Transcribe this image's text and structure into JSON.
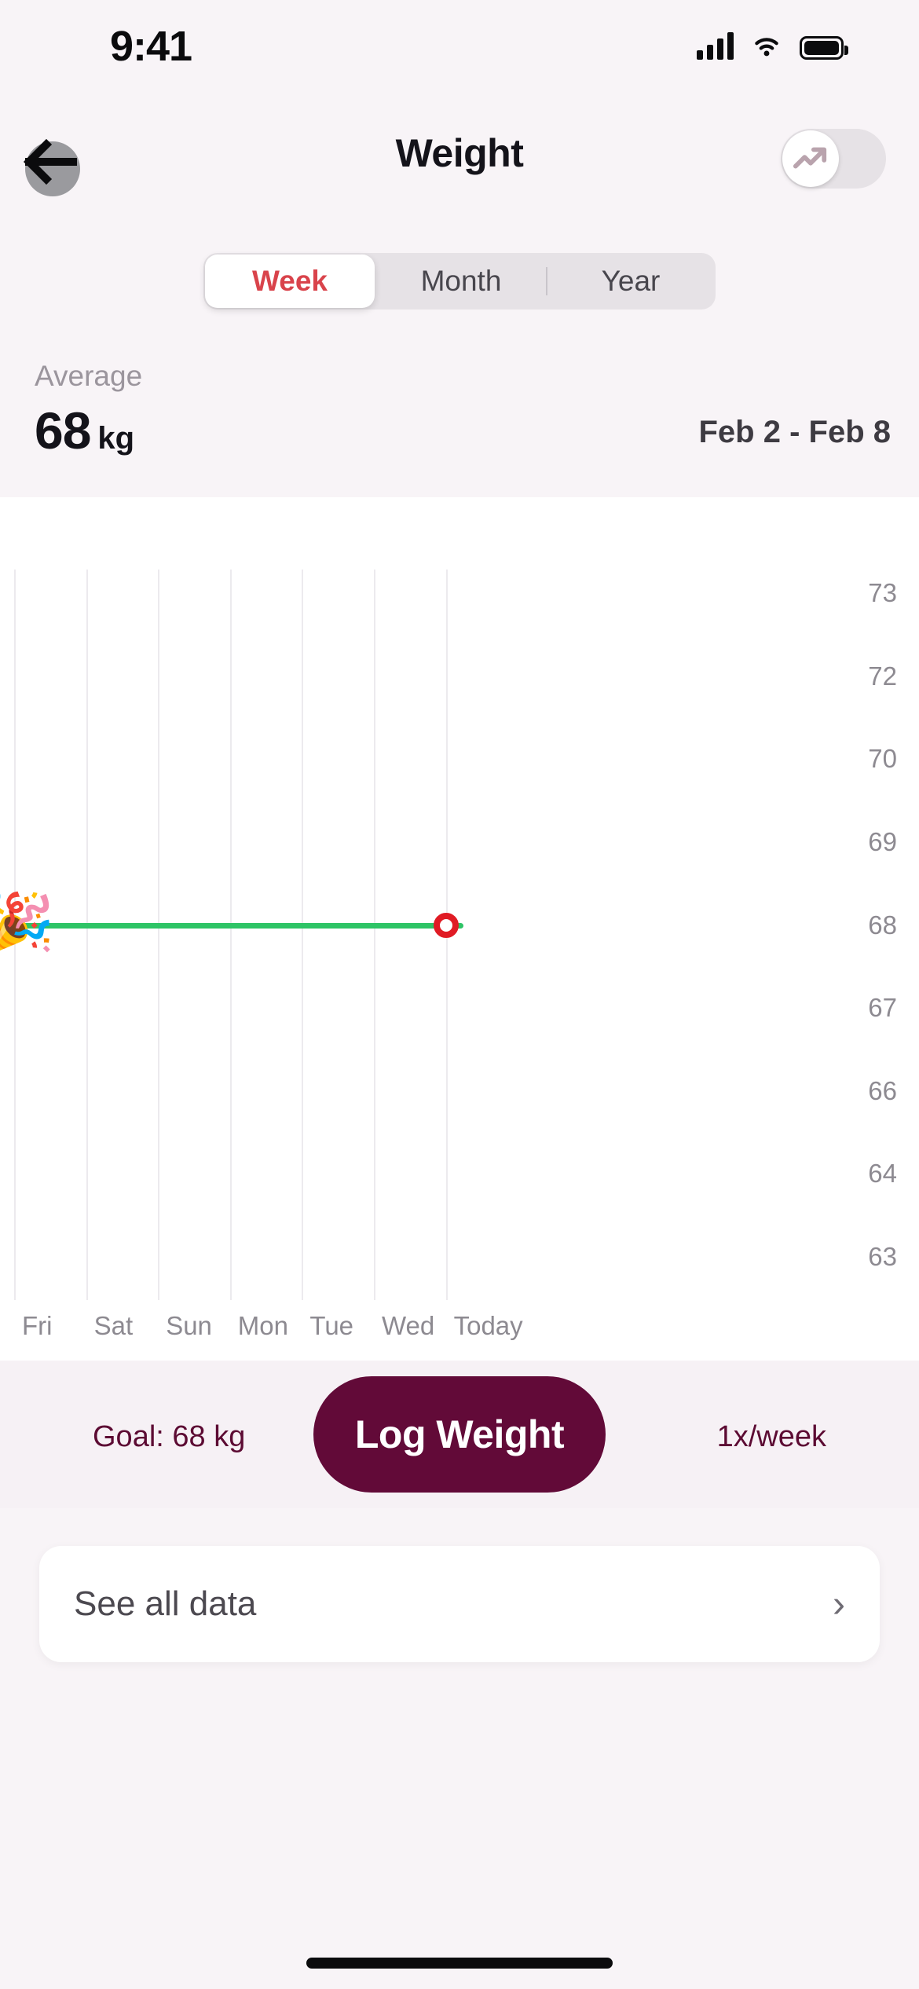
{
  "status_bar": {
    "time": "9:41",
    "cellular_icon": "signal-bars-icon",
    "wifi_icon": "wifi-icon",
    "battery_icon": "battery-full-icon"
  },
  "nav": {
    "back_icon": "back-arrow-icon",
    "title": "Weight",
    "toggle_icon": "trending-up-icon",
    "toggle_state": "off"
  },
  "segmented": {
    "options": [
      {
        "label": "Week",
        "selected": true
      },
      {
        "label": "Month",
        "selected": false
      },
      {
        "label": "Year",
        "selected": false
      }
    ],
    "active_color": "#d9434b"
  },
  "summary": {
    "average_label": "Average",
    "average_value": "68",
    "average_unit": "kg",
    "date_range": "Feb 2 - Feb 8"
  },
  "chart_data": {
    "type": "line",
    "title": "",
    "xlabel": "",
    "ylabel": "",
    "categories": [
      "Fri",
      "Sat",
      "Sun",
      "Mon",
      "Tue",
      "Wed",
      "Today"
    ],
    "y_ticks": [
      "73",
      "72",
      "70",
      "69",
      "68",
      "67",
      "66",
      "64",
      "63"
    ],
    "ylim": [
      63,
      73
    ],
    "grid": true,
    "series": [
      {
        "name": "Goal line",
        "type": "reference-line",
        "value": 68,
        "color": "#2ec466",
        "start_label": "party-popper-emoji",
        "start_glyph": "🎉"
      },
      {
        "name": "Weight",
        "points": [
          {
            "x": "Today",
            "y": 68,
            "marker": "hollow-circle",
            "color": "#e01b24"
          }
        ]
      }
    ]
  },
  "actions": {
    "goal_text": "Goal: 68 kg",
    "log_button": "Log Weight",
    "frequency_text": "1x/week",
    "brand_color": "#620a38"
  },
  "see_all": {
    "label": "See all data",
    "chevron_icon": "chevron-right-icon",
    "chevron_glyph": "›"
  }
}
